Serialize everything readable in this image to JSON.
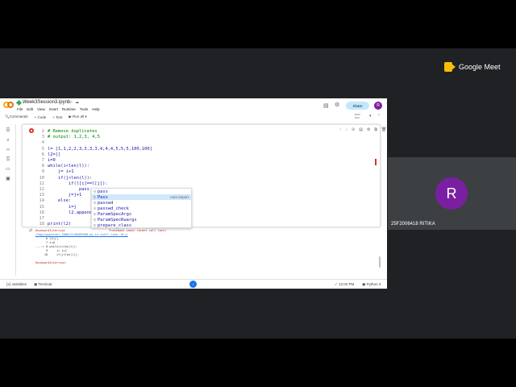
{
  "meet": {
    "logo_text": "Google Meet",
    "participant": {
      "initial": "R",
      "name": "25F2006418 RITIKA",
      "avatar_color": "#7b1fa2"
    }
  },
  "colab": {
    "notebook_title": "Week3Session3.ipynb",
    "menu": [
      "File",
      "Edit",
      "View",
      "Insert",
      "Runtime",
      "Tools",
      "Help"
    ],
    "share_label": "Share",
    "user_initial": "R",
    "toolbar": {
      "commands": "Commands",
      "code": "+ Code",
      "text": "+ Text",
      "run_all": "Run all",
      "ram": "RAM",
      "disk": "Disk"
    },
    "code_lines": [
      {
        "n": "2",
        "text": "# Remove duplicates",
        "comment": true
      },
      {
        "n": "3",
        "text": "# output: 1,2,3, 4,5",
        "comment": true
      },
      {
        "n": "4",
        "text": "",
        "comment": false
      },
      {
        "n": "5",
        "text": "l= [1,1,2,2,3,3,3,3,4,4,4,5,5,5,100,100]",
        "comment": false
      },
      {
        "n": "6",
        "text": "l2=[]",
        "comment": false
      },
      {
        "n": "7",
        "text": "i=0",
        "comment": false
      },
      {
        "n": "8",
        "text": "while(i<len(l)):",
        "comment": false
      },
      {
        "n": "9",
        "text": "    j= i+1",
        "comment": false
      },
      {
        "n": "10",
        "text": "    if(j<len(l)):",
        "comment": false
      },
      {
        "n": "11",
        "text": "        if(l[i]==l[j]):",
        "comment": false
      },
      {
        "n": "12",
        "text": "            pass",
        "comment": false
      },
      {
        "n": "13",
        "text": "        j=j+1",
        "comment": false
      },
      {
        "n": "14",
        "text": "    else:",
        "comment": false
      },
      {
        "n": "15",
        "text": "        i=j",
        "comment": false
      },
      {
        "n": "16",
        "text": "        l2.append",
        "comment": false
      },
      {
        "n": "17",
        "text": "",
        "comment": false
      },
      {
        "n": "18",
        "text": "print(l2)",
        "comment": false
      }
    ],
    "autocomplete": {
      "hint": "Auto-import",
      "items": [
        "pass",
        "Pass",
        "passwd",
        "passwd_check",
        "ParamSpecArgs",
        "ParamSpecKwargs",
        "prepare_class"
      ],
      "selected_index": 1
    },
    "output_lines": [
      {
        "text": "KeyboardInterrupt                         Traceback (most recent call last)",
        "kind": "err"
      },
      {
        "text": "/tmp/ipykernel_2086/2140283308.py in <cell line: 0>()",
        "kind": "link"
      },
      {
        "text": "      6 l2=[]",
        "kind": "plain"
      },
      {
        "text": "      7 i=0",
        "kind": "plain"
      },
      {
        "text": "----> 8 while(i<len(l)):",
        "kind": "plain"
      },
      {
        "text": "      9     j= i+1",
        "kind": "plain"
      },
      {
        "text": "     10     if(j<len(l)):",
        "kind": "plain"
      },
      {
        "text": "",
        "kind": "plain"
      },
      {
        "text": "KeyboardInterrupt:",
        "kind": "err"
      }
    ],
    "status": {
      "variables": "Variables",
      "terminal": "Terminal",
      "time": "12:02 PM",
      "kernel": "Python 3"
    }
  }
}
